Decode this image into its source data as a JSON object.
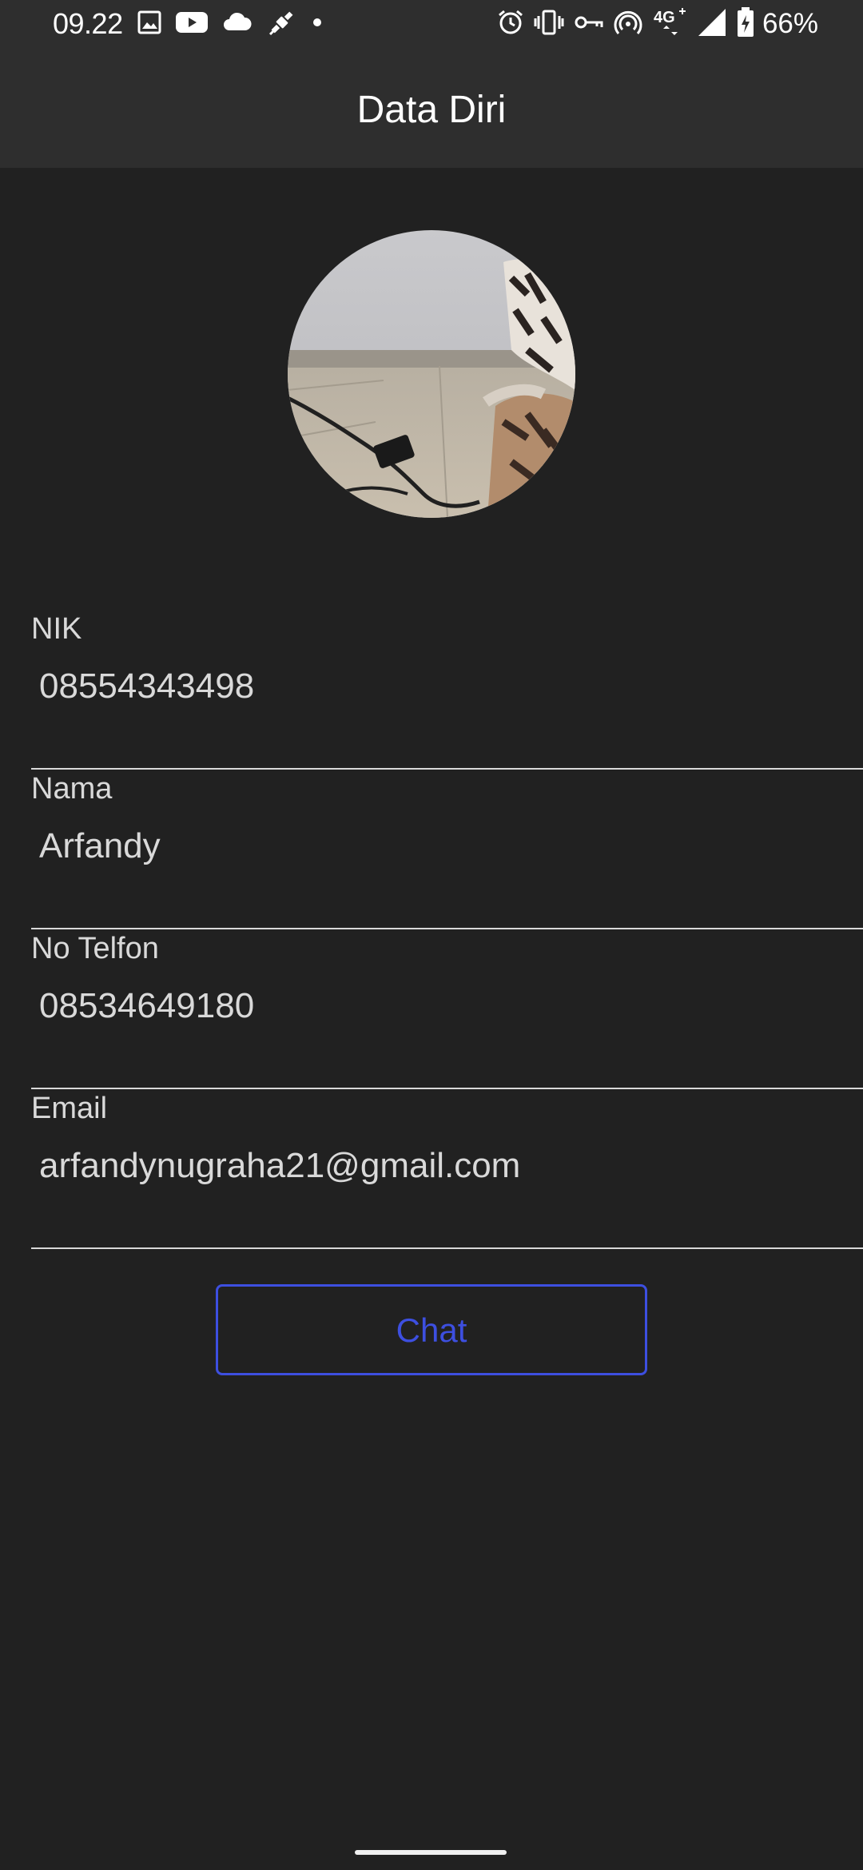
{
  "status_bar": {
    "time": "09.22",
    "battery_percent": "66%",
    "network": "4G",
    "left_icons": [
      "image-icon",
      "youtube-icon",
      "cloud-icon",
      "satellite-icon",
      "dot-icon"
    ],
    "right_icons": [
      "alarm-icon",
      "vibrate-icon",
      "vpn-key-icon",
      "hotspot-icon",
      "network-4g-icon",
      "signal-icon",
      "battery-icon"
    ]
  },
  "app_bar": {
    "title": "Data Diri"
  },
  "profile": {
    "avatar_icon": "profile-photo"
  },
  "fields": [
    {
      "label": "NIK",
      "value": "08554343498"
    },
    {
      "label": "Nama",
      "value": "Arfandy"
    },
    {
      "label": "No Telfon",
      "value": "08534649180"
    },
    {
      "label": "Email",
      "value": "arfandynugraha21@gmail.com"
    }
  ],
  "actions": {
    "chat_label": "Chat"
  },
  "colors": {
    "background": "#212121",
    "app_bar": "#2e2e2e",
    "accent": "#3d4fe0",
    "text": "#d9d9d9"
  }
}
